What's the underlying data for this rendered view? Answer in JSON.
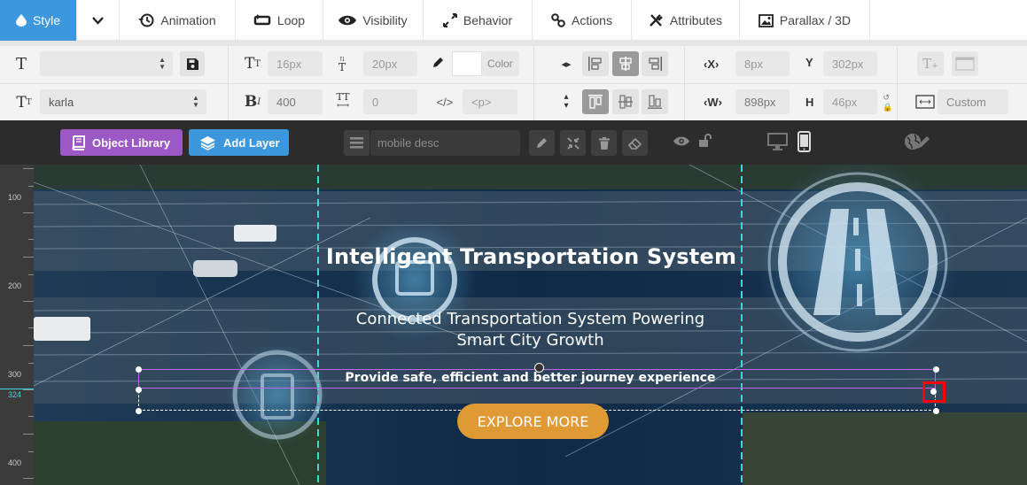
{
  "tabs": [
    {
      "label": "Style",
      "icon": "droplet-icon",
      "active": true
    },
    {
      "label": "",
      "icon": "chevron-down-icon"
    },
    {
      "label": "Animation",
      "icon": "history-icon"
    },
    {
      "label": "Loop",
      "icon": "loop-icon"
    },
    {
      "label": "Visibility",
      "icon": "eye-icon"
    },
    {
      "label": "Behavior",
      "icon": "expand-arrows-icon"
    },
    {
      "label": "Actions",
      "icon": "link-icon"
    },
    {
      "label": "Attributes",
      "icon": "tools-icon"
    },
    {
      "label": "Parallax / 3D",
      "icon": "image-icon"
    }
  ],
  "toolbar": {
    "font_size": "16px",
    "line_height": "20px",
    "color_label": "Color",
    "font_family": "karla",
    "font_weight": "400",
    "letter_spacing": "0",
    "tag": "<p>",
    "x_label": "X",
    "x_value": "8px",
    "y_label": "Y",
    "y_value": "302px",
    "w_label": "W",
    "w_value": "898px",
    "h_label": "H",
    "h_value": "46px",
    "size_preset": "Custom"
  },
  "darkbar": {
    "object_library": "Object Library",
    "add_layer": "Add Layer",
    "layer_name": "mobile desc"
  },
  "ruler": {
    "marks": [
      "100",
      "200",
      "300",
      "324",
      "400"
    ]
  },
  "canvas": {
    "title": "Intelligent Transportation System",
    "subtitle_line1": "Connected Transportation System Powering",
    "subtitle_line2": "Smart City Growth",
    "description": "Provide safe, efficient and better journey experience",
    "cta": "EXPLORE MORE"
  },
  "colors": {
    "accent_tab": "#3c97dd",
    "object_library": "#9c59c5",
    "add_layer": "#3c97dd",
    "cta_bg": "#e09a35",
    "guide": "#3ed7e0",
    "selection_line": "#c166e8",
    "handle_highlight": "#ff0000"
  }
}
